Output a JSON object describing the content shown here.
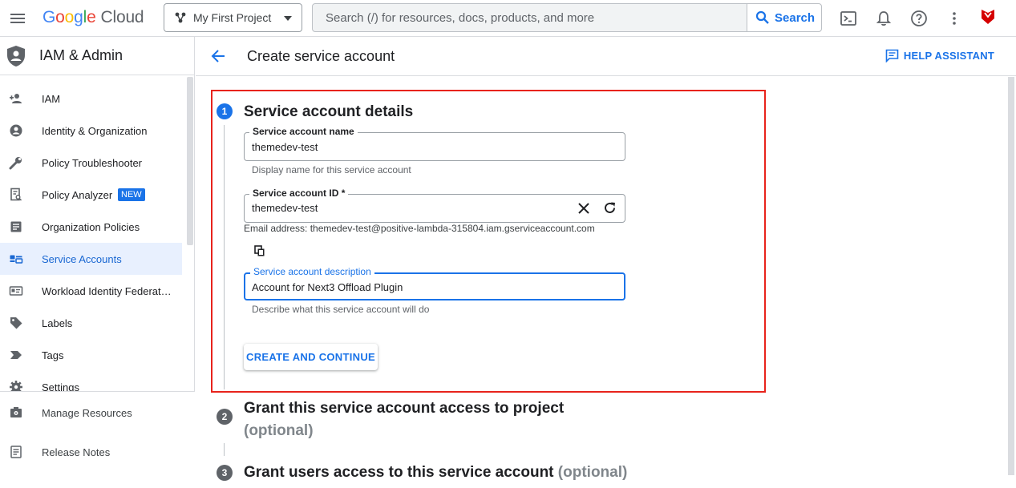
{
  "topbar": {
    "logo_google": [
      "G",
      "o",
      "o",
      "g",
      "l",
      "e"
    ],
    "logo_cloud": "Cloud",
    "project": "My First Project",
    "search_placeholder": "Search (/) for resources, docs, products, and more",
    "search_button": "Search"
  },
  "sidebar": {
    "title": "IAM & Admin",
    "items": [
      {
        "label": "IAM",
        "icon": "person-add-icon"
      },
      {
        "label": "Identity & Organization",
        "icon": "account-circle-icon"
      },
      {
        "label": "Policy Troubleshooter",
        "icon": "wrench-icon"
      },
      {
        "label": "Policy Analyzer",
        "icon": "document-search-icon",
        "badge": "NEW"
      },
      {
        "label": "Organization Policies",
        "icon": "list-document-icon"
      },
      {
        "label": "Service Accounts",
        "icon": "service-account-icon",
        "active": true
      },
      {
        "label": "Workload Identity Federat…",
        "icon": "id-card-icon"
      },
      {
        "label": "Labels",
        "icon": "label-icon"
      },
      {
        "label": "Tags",
        "icon": "tag-chevron-icon"
      },
      {
        "label": "Settings",
        "icon": "gear-icon"
      }
    ],
    "bottom_items": [
      {
        "label": "Manage Resources",
        "icon": "manage-resources-icon"
      },
      {
        "label": "Release Notes",
        "icon": "release-notes-icon"
      }
    ]
  },
  "header": {
    "title": "Create service account",
    "help": "HELP ASSISTANT"
  },
  "steps": [
    {
      "number": "1",
      "title": "Service account details"
    },
    {
      "number": "2",
      "title": "Grant this service account access to project",
      "optional": "(optional)"
    },
    {
      "number": "3",
      "title": "Grant users access to this service account",
      "optional": "(optional)"
    }
  ],
  "form": {
    "name_label": "Service account name",
    "name_value": "themedev-test",
    "name_hint": "Display name for this service account",
    "id_label": "Service account ID *",
    "id_value": "themedev-test",
    "email": "Email address: themedev-test@positive-lambda-315804.iam.gserviceaccount.com",
    "desc_label": "Service account description",
    "desc_value": "Account for Next3 Offload Plugin",
    "desc_hint": "Describe what this service account will do",
    "create_button": "CREATE AND CONTINUE"
  },
  "colors": {
    "accent": "#1a73e8",
    "highlight": "#e8231c",
    "active_bg": "#e8f0fe"
  }
}
